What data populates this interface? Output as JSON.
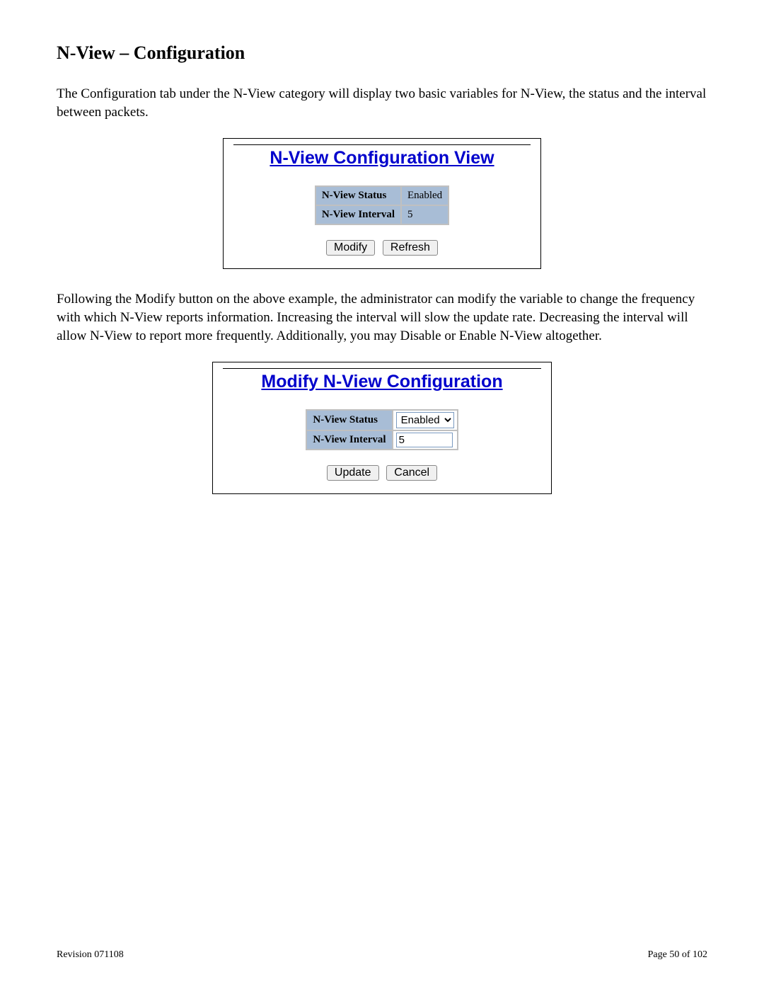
{
  "section_title": "N-View – Configuration",
  "intro_para": "The Configuration tab under the N-View category will display two basic variables for N-View, the status and the interval between packets.",
  "view_panel": {
    "title": "N-View Configuration View",
    "rows": {
      "status_label": "N-View Status",
      "status_value": "Enabled",
      "interval_label": "N-View Interval",
      "interval_value": "5"
    },
    "buttons": {
      "modify": "Modify",
      "refresh": "Refresh"
    }
  },
  "mid_para": "Following the Modify button on the above example, the administrator can modify the variable to change the frequency with which N-View reports information.  Increasing the interval will slow the update rate.  Decreasing the interval will allow N-View to report more frequently.  Additionally, you may Disable or Enable N-View altogether.",
  "modify_panel": {
    "title": "Modify N-View Configuration",
    "rows": {
      "status_label": "N-View Status",
      "status_select_value": "Enabled",
      "interval_label": "N-View Interval",
      "interval_input_value": "5"
    },
    "buttons": {
      "update": "Update",
      "cancel": "Cancel"
    }
  },
  "footer": {
    "revision": "Revision 071108",
    "page": "Page 50 of 102"
  }
}
